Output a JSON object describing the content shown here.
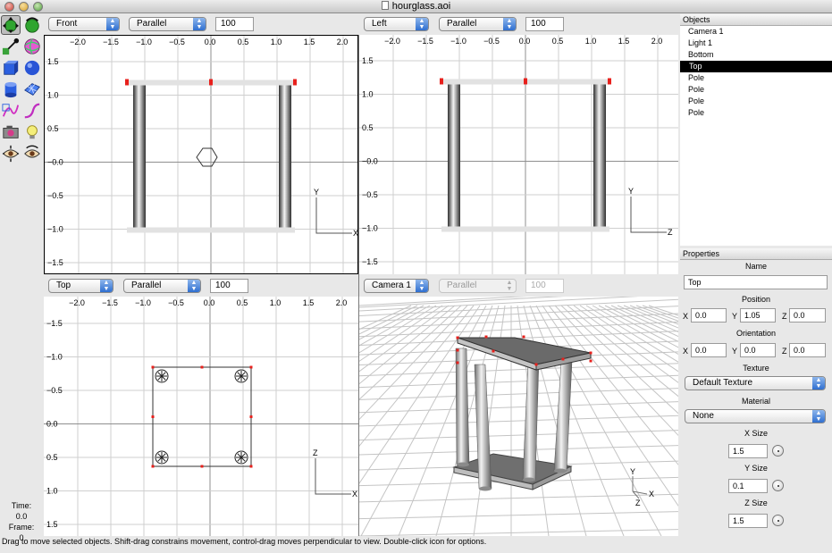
{
  "window": {
    "title": "hourglass.aoi"
  },
  "tools": [
    "move-icon",
    "rotate-icon",
    "eyedropper-icon",
    "texture-sphere-icon",
    "cube-icon",
    "sphere-icon",
    "cylinder-icon",
    "polymesh-icon",
    "spline-icon",
    "curve-icon",
    "camera-icon",
    "light-bulb-icon",
    "eye-icon",
    "eye-dragger-icon"
  ],
  "viewports": {
    "top_left": {
      "view": "Front",
      "projection": "Parallel",
      "scale": "100"
    },
    "top_right": {
      "view": "Left",
      "projection": "Parallel",
      "scale": "100"
    },
    "bottom_left": {
      "view": "Top",
      "projection": "Parallel",
      "scale": "100"
    },
    "bottom_right": {
      "view": "Camera 1",
      "projection": "Parallel",
      "scale": "100"
    }
  },
  "axis_ticks": {
    "h": [
      "−2.0",
      "−1.5",
      "−1.0",
      "−0.5",
      "0.0",
      "0.5",
      "1.0",
      "1.5",
      "2.0"
    ],
    "v_front": [
      "1.5",
      "1.0",
      "0.5",
      "−0.0",
      "−0.5",
      "−1.0",
      "−1.5"
    ],
    "v_top": [
      "−1.5",
      "−1.0",
      "−0.5",
      "0.0",
      "0.5",
      "1.0",
      "1.5"
    ]
  },
  "axis_labels": {
    "y": "Y",
    "x": "X",
    "z": "Z"
  },
  "time": {
    "time_label": "Time:",
    "time_value": "0.0",
    "frame_label": "Frame:",
    "frame_value": "0"
  },
  "status": "Drag to move selected objects.  Shift-drag constrains movement, control-drag moves perpendicular to view.  Double-click icon for options.",
  "objects": {
    "header": "Objects",
    "items": [
      {
        "label": "Camera 1",
        "selected": false
      },
      {
        "label": "Light 1",
        "selected": false
      },
      {
        "label": "Bottom",
        "selected": false
      },
      {
        "label": "Top",
        "selected": true
      },
      {
        "label": "Pole",
        "selected": false
      },
      {
        "label": "Pole",
        "selected": false
      },
      {
        "label": "Pole",
        "selected": false
      },
      {
        "label": "Pole",
        "selected": false
      }
    ]
  },
  "properties": {
    "header": "Properties",
    "name_label": "Name",
    "name_value": "Top",
    "position_label": "Position",
    "position": {
      "x": "0.0",
      "y": "1.05",
      "z": "0.0"
    },
    "orientation_label": "Orientation",
    "orientation": {
      "x": "0.0",
      "y": "0.0",
      "z": "0.0"
    },
    "coord_x": "X",
    "coord_y": "Y",
    "coord_z": "Z",
    "texture_label": "Texture",
    "texture_value": "Default Texture",
    "material_label": "Material",
    "material_value": "None",
    "xsize_label": "X Size",
    "xsize_value": "1.5",
    "ysize_label": "Y Size",
    "ysize_value": "0.1",
    "zsize_label": "Z Size",
    "zsize_value": "1.5"
  },
  "colors": {
    "handle": "#e8201c",
    "selection_bg": "#000000",
    "pole_dark": "#2e2e2e",
    "pole_light": "#f4f4f4",
    "grid": "#c8c8c8"
  }
}
